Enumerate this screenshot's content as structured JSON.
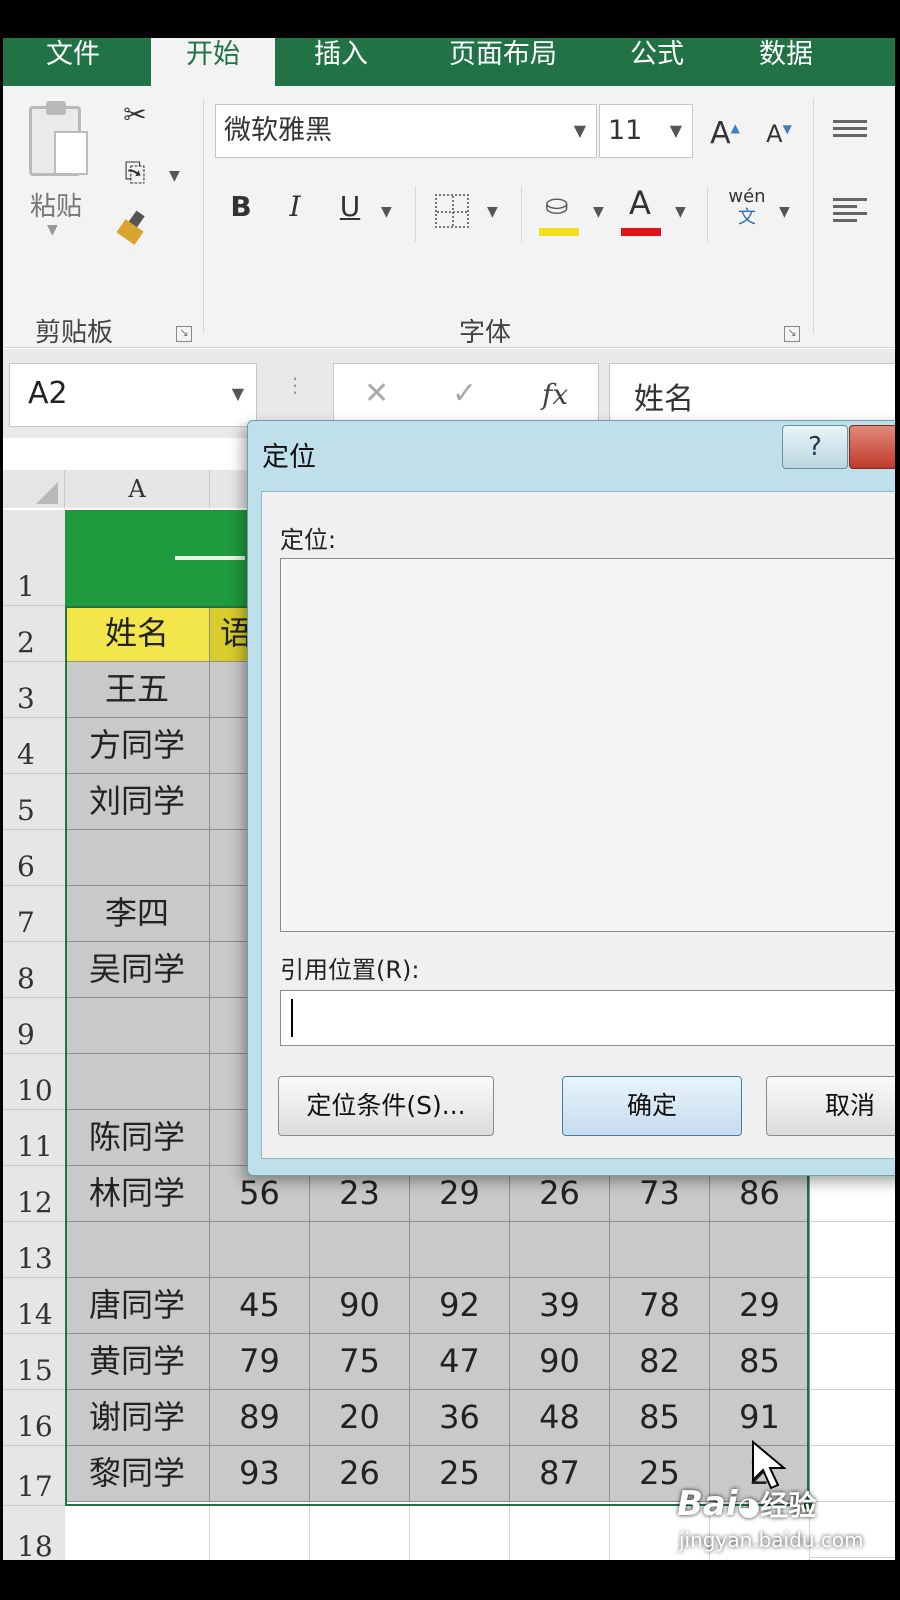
{
  "ribbon_tabs": [
    "文件",
    "开始",
    "插入",
    "页面布局",
    "公式",
    "数据"
  ],
  "ribbon": {
    "paste_label": "粘贴",
    "clipboard_group": "剪贴板",
    "font_group": "字体",
    "font_name": "微软雅黑",
    "font_size": "11",
    "bold": "B",
    "italic": "I",
    "underline": "U",
    "font_color_letter": "A",
    "phonetic": "wén",
    "phonetic_sub": "文",
    "grow_font": "A",
    "shrink_font": "A"
  },
  "formula_bar": {
    "name_box": "A2",
    "cancel": "✕",
    "enter": "✓",
    "fx": "fx",
    "content": "姓名"
  },
  "sheet": {
    "col_header_a": "A",
    "row_numbers": [
      "1",
      "2",
      "3",
      "4",
      "5",
      "6",
      "7",
      "8",
      "9",
      "10",
      "11",
      "12",
      "13",
      "14",
      "15",
      "16",
      "17",
      "18"
    ],
    "header_cell": "姓名",
    "header_cell_b_partial": "语",
    "names": [
      "王五",
      "方同学",
      "刘同学",
      "",
      "李四",
      "吴同学",
      "",
      "",
      "陈同学",
      "林同学",
      "",
      "唐同学",
      "黄同学",
      "谢同学",
      "黎同学"
    ],
    "visible_rows": [
      {
        "name": "林同学",
        "scores": [
          "56",
          "23",
          "29",
          "26",
          "73",
          "86"
        ]
      },
      {
        "name": "",
        "scores": [
          "",
          "",
          "",
          "",
          "",
          ""
        ]
      },
      {
        "name": "唐同学",
        "scores": [
          "45",
          "90",
          "92",
          "39",
          "78",
          "29"
        ]
      },
      {
        "name": "黄同学",
        "scores": [
          "79",
          "75",
          "47",
          "90",
          "82",
          "85"
        ]
      },
      {
        "name": "谢同学",
        "scores": [
          "89",
          "20",
          "36",
          "48",
          "85",
          "91"
        ]
      },
      {
        "name": "黎同学",
        "scores": [
          "93",
          "26",
          "25",
          "87",
          "25",
          "2"
        ]
      }
    ]
  },
  "dialog": {
    "title": "定位",
    "help": "?",
    "goto_label": "定位:",
    "reference_label": "引用位置(R):",
    "reference_value": "",
    "special_button": "定位条件(S)...",
    "ok_button": "确定",
    "cancel_button": "取消"
  },
  "watermark": {
    "brand": "Bai",
    "brand2": "经验",
    "url": "jingyan.baidu.com"
  },
  "colors": {
    "excel_green": "#217346",
    "header_yellow": "#f2e64a",
    "title_row_green": "#1f9a3e",
    "dialog_frame": "#bfe0ea"
  }
}
